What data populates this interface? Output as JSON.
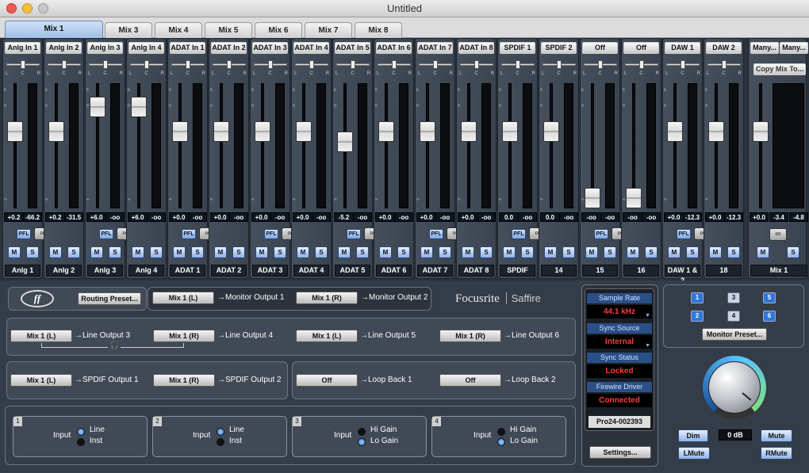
{
  "window": {
    "title": "Untitled"
  },
  "tabs": [
    {
      "label": "Mix 1",
      "active": true
    },
    {
      "label": "Mix 3"
    },
    {
      "label": "Mix 4"
    },
    {
      "label": "Mix 5"
    },
    {
      "label": "Mix 6"
    },
    {
      "label": "Mix 7"
    },
    {
      "label": "Mix 8"
    }
  ],
  "strips": [
    {
      "name": "Anlg In 1",
      "readout": [
        "+0.2",
        "-66.2"
      ],
      "output": "Anlg 1",
      "fader": 0.64
    },
    {
      "name": "Anlg In 2",
      "readout": [
        "+0.2",
        "-31.5"
      ],
      "output": "Anlg 2",
      "fader": 0.64
    },
    {
      "name": "Anlg In 3",
      "readout": [
        "+6.0",
        "-oo"
      ],
      "output": "Anlg 3",
      "fader": 0.87
    },
    {
      "name": "Anlg In 4",
      "readout": [
        "+6.0",
        "-oo"
      ],
      "output": "Anlg 4",
      "fader": 0.87
    },
    {
      "name": "ADAT In 1",
      "readout": [
        "+0.0",
        "-oo"
      ],
      "output": "ADAT 1",
      "fader": 0.64
    },
    {
      "name": "ADAT In 2",
      "readout": [
        "+0.0",
        "-oo"
      ],
      "output": "ADAT 2",
      "fader": 0.64
    },
    {
      "name": "ADAT In 3",
      "readout": [
        "+0.0",
        "-oo"
      ],
      "output": "ADAT 3",
      "fader": 0.64
    },
    {
      "name": "ADAT In 4",
      "readout": [
        "+0.0",
        "-oo"
      ],
      "output": "ADAT 4",
      "fader": 0.64
    },
    {
      "name": "ADAT In 5",
      "readout": [
        "-5.2",
        "-oo"
      ],
      "output": "ADAT 5",
      "fader": 0.54
    },
    {
      "name": "ADAT In 6",
      "readout": [
        "+0.0",
        "-oo"
      ],
      "output": "ADAT 6",
      "fader": 0.64
    },
    {
      "name": "ADAT In 7",
      "readout": [
        "+0.0",
        "-oo"
      ],
      "output": "ADAT 7",
      "fader": 0.64
    },
    {
      "name": "ADAT In 8",
      "readout": [
        "+0.0",
        "-oo"
      ],
      "output": "ADAT 8",
      "fader": 0.64
    },
    {
      "name": "SPDIF 1",
      "readout": [
        "0.0",
        "-oo"
      ],
      "output": "SPDIF",
      "fader": 0.64
    },
    {
      "name": "SPDIF 2",
      "readout": [
        "0.0",
        "-oo"
      ],
      "output": "14",
      "fader": 0.64
    },
    {
      "name": "Off",
      "readout": [
        "-oo",
        "-oo"
      ],
      "output": "15",
      "fader": 0.0
    },
    {
      "name": "Off",
      "readout": [
        "-oo",
        "-oo"
      ],
      "output": "16",
      "fader": 0.0
    },
    {
      "name": "DAW 1",
      "readout": [
        "+0.0",
        "-12.3"
      ],
      "output": "DAW 1 & 2",
      "fader": 0.64
    },
    {
      "name": "DAW 2",
      "readout": [
        "+0.0",
        "-12.3"
      ],
      "output": "18",
      "fader": 0.64
    }
  ],
  "master": {
    "many1": "Many...",
    "many2": "Many...",
    "copy": "Copy Mix To...",
    "readout": [
      "+0.0",
      "-3.4",
      "-4.8"
    ],
    "output": "Mix 1",
    "fader": 0.64
  },
  "labels": {
    "pfl": "PFL",
    "m": "M",
    "s": "S",
    "link": "∞"
  },
  "routing": {
    "preset_btn": "Routing Preset...",
    "monitor": [
      {
        "src": "Mix 1 (L)",
        "dest": "Monitor Output 1"
      },
      {
        "src": "Mix 1 (R)",
        "dest": "Monitor Output 2"
      }
    ],
    "line": [
      {
        "src": "Mix 1 (L)",
        "dest": "Line Output 3"
      },
      {
        "src": "Mix 1 (R)",
        "dest": "Line Output 4"
      },
      {
        "src": "Mix 1 (L)",
        "dest": "Line Output 5"
      },
      {
        "src": "Mix 1 (R)",
        "dest": "Line Output 6"
      }
    ],
    "spdif": [
      {
        "src": "Mix 1 (L)",
        "dest": "SPDIF Output 1"
      },
      {
        "src": "Mix 1 (R)",
        "dest": "SPDIF Output 2"
      }
    ],
    "loop": [
      {
        "src": "Off",
        "dest": "Loop Back 1"
      },
      {
        "src": "Off",
        "dest": "Loop Back 2"
      }
    ]
  },
  "brand": {
    "name": "Focusrite",
    "product": "Saffire"
  },
  "status": {
    "sample_rate_label": "Sample Rate",
    "sample_rate": "44.1 kHz",
    "sync_source_label": "Sync Source",
    "sync_source": "Internal",
    "sync_status_label": "Sync Status",
    "sync_status": "Locked",
    "driver_label": "Firewire Driver",
    "driver": "Connected",
    "device": "Pro24-002393",
    "settings": "Settings..."
  },
  "monitor": {
    "preset": "Monitor Preset...",
    "numbers": [
      "1",
      "2",
      "3",
      "4",
      "5",
      "6"
    ],
    "db": "0 dB",
    "dim": "Dim",
    "mute": "Mute",
    "lmute": "LMute",
    "rmute": "RMute"
  },
  "inputs": [
    {
      "num": "1",
      "label": "Input",
      "opt1": "Line",
      "opt2": "Inst",
      "sel": 0
    },
    {
      "num": "2",
      "label": "Input",
      "opt1": "Line",
      "opt2": "Inst",
      "sel": 0
    },
    {
      "num": "3",
      "label": "Input",
      "opt1": "Hi Gain",
      "opt2": "Lo Gain",
      "sel": 1
    },
    {
      "num": "4",
      "label": "Input",
      "opt1": "Hi Gain",
      "opt2": "Lo Gain",
      "sel": 1
    }
  ],
  "colors": {
    "accent": "#2a4f86",
    "alert": "#ff3b3b",
    "link_blue": "#3a7fe0"
  }
}
